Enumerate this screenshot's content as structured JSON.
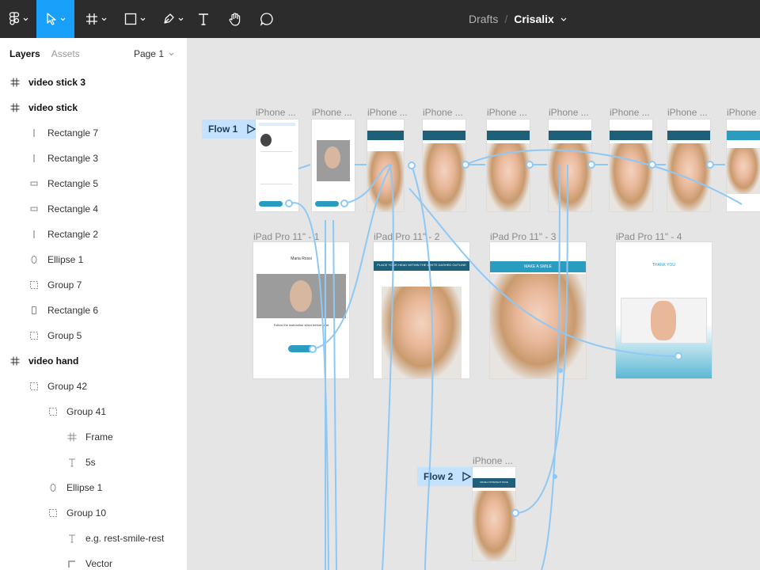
{
  "toolbar": {
    "tools": [
      "main-menu",
      "move",
      "frame",
      "shape",
      "pen",
      "text",
      "hand",
      "comment"
    ]
  },
  "breadcrumb": {
    "drafts": "Drafts",
    "separator": "/",
    "file": "Crisalix"
  },
  "sidebar": {
    "tab_layers": "Layers",
    "tab_assets": "Assets",
    "page": "Page 1",
    "layers": [
      {
        "label": "video stick 3",
        "icon": "frame-icon",
        "top": true
      },
      {
        "label": "video stick",
        "icon": "frame-icon",
        "top": true
      },
      {
        "label": "Rectangle 7",
        "icon": "rectangle-icon"
      },
      {
        "label": "Rectangle 3",
        "icon": "rectangle-icon"
      },
      {
        "label": "Rectangle 5",
        "icon": "rectangle-icon"
      },
      {
        "label": "Rectangle 4",
        "icon": "rectangle-icon"
      },
      {
        "label": "Rectangle 2",
        "icon": "rectangle-icon"
      },
      {
        "label": "Ellipse 1",
        "icon": "ellipse-icon"
      },
      {
        "label": "Group 7",
        "icon": "group-icon"
      },
      {
        "label": "Rectangle 6",
        "icon": "rectangle-icon"
      },
      {
        "label": "Group 5",
        "icon": "group-icon"
      },
      {
        "label": "video hand",
        "icon": "frame-icon",
        "top": true
      },
      {
        "label": "Group 42",
        "icon": "group-icon"
      },
      {
        "label": "Group 41",
        "icon": "group-icon"
      },
      {
        "label": "Frame",
        "icon": "frame-icon"
      },
      {
        "label": "5s",
        "icon": "text-icon"
      },
      {
        "label": "Ellipse 1",
        "icon": "ellipse-icon"
      },
      {
        "label": "Group 10",
        "icon": "group-icon"
      },
      {
        "label": "e.g. rest-smile-rest",
        "icon": "text-icon"
      },
      {
        "label": "Vector",
        "icon": "vector-icon"
      }
    ]
  },
  "canvas": {
    "flows": [
      "Flow 1",
      "Flow 2"
    ],
    "iphone_label": "iPhone ...",
    "ipad_labels": [
      "iPad Pro 11\" - 1",
      "iPad Pro 11\" - 2",
      "iPad Pro 11\" - 3",
      "iPad Pro 11\" - 4"
    ],
    "frame_texts": {
      "place_head": "PLACE YOUR HEAD WITHIN THE WHITE DASHED OUTLINE",
      "make_smile": "MAKE A SMILE",
      "thank_you": "THANK YOU",
      "follow": "Follow the instruction video before start",
      "name": "Maria Rossi",
      "straight": "MAKE A STRAIGHT FACE"
    }
  },
  "colors": {
    "accent": "#18a0fb",
    "toolbar": "#2c2c2c",
    "teal": "#2a9cbf",
    "connector": "#8ec8f5"
  }
}
